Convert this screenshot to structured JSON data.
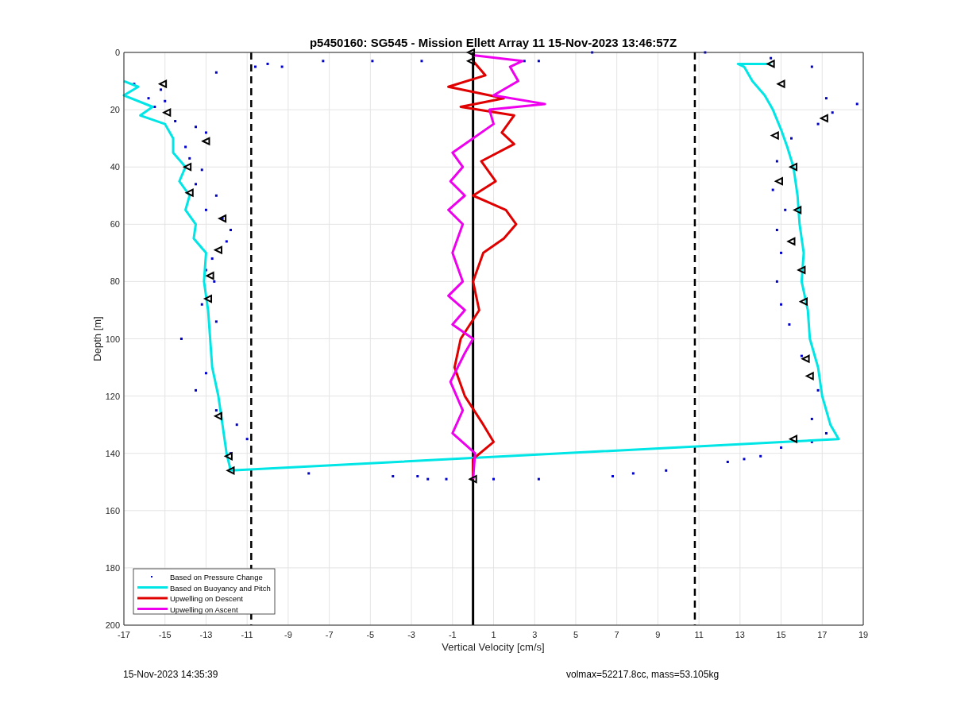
{
  "figure": {
    "chart_data": {
      "type": "line",
      "title": "p5450160: SG545 - Mission Ellett Array 11 15-Nov-2023 13:46:57Z",
      "xlabel": "Vertical Velocity [cm/s]",
      "ylabel": "Depth [m]",
      "xlim": [
        -17,
        19
      ],
      "ylim": [
        200,
        0
      ],
      "xticks": [
        -17,
        -15,
        -13,
        -11,
        -9,
        -7,
        -5,
        -3,
        -1,
        1,
        3,
        5,
        7,
        9,
        11,
        13,
        15,
        17,
        19
      ],
      "yticks": [
        0,
        20,
        40,
        60,
        80,
        100,
        120,
        140,
        160,
        180,
        200
      ],
      "series": [
        {
          "name": "Based on Pressure Change",
          "type": "scatter",
          "color": "#0000cc",
          "x": [
            -16.5,
            -15.2,
            -15.8,
            -15,
            -15.5,
            -14.5,
            -13.5,
            -13,
            -14,
            -13.8,
            -13.2,
            -13.5,
            -12.5,
            -13,
            -12.2,
            -11.8,
            -12,
            -12.7,
            -13,
            -12.6,
            -13.2,
            -12.5,
            -14.2,
            -13,
            -13.5,
            -12.5,
            -11.5,
            -11,
            -11.8,
            -12.5,
            -10.6,
            -10,
            -9.3,
            -7.3,
            -4.9,
            -2.5,
            2.5,
            3.2,
            5.8,
            -8,
            -3.9,
            -2.7,
            -2.2,
            -1.3,
            1,
            3.2,
            6.8,
            7.8,
            9.4,
            12.4,
            13.2,
            14,
            15,
            16.5,
            17.2,
            16.5,
            16.8,
            16,
            15.4,
            15,
            14.8,
            15,
            14.8,
            15.2,
            14.6,
            14.8,
            15.5,
            16.8,
            17.5,
            17.2,
            18.7,
            16.5,
            14.5,
            11.3
          ],
          "values": [
            11,
            13,
            16,
            17,
            19,
            24,
            26,
            28,
            33,
            37,
            41,
            46,
            50,
            55,
            58,
            62,
            66,
            72,
            76,
            80,
            88,
            94,
            100,
            112,
            118,
            125,
            130,
            135,
            140,
            7,
            5,
            4,
            5,
            3,
            3,
            3,
            3,
            3,
            0,
            147,
            148,
            148,
            149,
            149,
            149,
            149,
            148,
            147,
            146,
            143,
            142,
            141,
            138,
            136,
            133,
            128,
            118,
            106,
            95,
            88,
            80,
            70,
            62,
            55,
            48,
            38,
            30,
            25,
            21,
            16,
            18,
            5,
            2,
            0
          ]
        },
        {
          "name": "Based on Buoyancy and Pitch",
          "type": "line",
          "color": "#00e5e5",
          "x": [
            -17,
            -16.3,
            -17,
            -15.6,
            -16.2,
            -15,
            -14.6,
            -14.6,
            -14,
            -14.3,
            -13.8,
            -14,
            -13.5,
            -13.6,
            -13,
            -13.1,
            -12.9,
            -12.8,
            -12.7,
            -12.4,
            -12.2,
            -12,
            -11.8,
            17.8,
            17.4,
            17,
            16.8,
            16.4,
            16.3,
            16,
            16.1,
            15.9,
            15.8,
            15.6,
            15.3,
            15,
            14.6,
            14.2,
            13.6,
            13.2,
            12.9,
            14.5
          ],
          "values": [
            10,
            12,
            15,
            19,
            22,
            25,
            30,
            35,
            40,
            45,
            50,
            55,
            60,
            65,
            70,
            80,
            90,
            100,
            110,
            120,
            130,
            140,
            146,
            135,
            130,
            120,
            110,
            100,
            90,
            80,
            70,
            60,
            50,
            40,
            33,
            27,
            20,
            15,
            10,
            5,
            4,
            4
          ]
        },
        {
          "name": "Upwelling on Descent",
          "type": "line",
          "color": "#e00000",
          "x": [
            0,
            0.6,
            -1.2,
            1.5,
            -0.6,
            2,
            1.4,
            2,
            0.4,
            1.1,
            0,
            1.6,
            2.1,
            1.5,
            0.5,
            0,
            0.3,
            -0.6,
            -0.9,
            -0.4,
            0.5,
            1,
            0,
            0
          ],
          "values": [
            3,
            8,
            12,
            16,
            19,
            22,
            28,
            32,
            38,
            45,
            50,
            55,
            60,
            65,
            70,
            80,
            90,
            100,
            110,
            120,
            130,
            136,
            142,
            149
          ]
        },
        {
          "name": "Upwelling on Ascent",
          "type": "line",
          "color": "#ee00ee",
          "x": [
            0,
            0.1,
            -1,
            -0.5,
            -1.1,
            -0.4,
            0,
            -1,
            -0.4,
            -1.2,
            -0.5,
            -1,
            -0.5,
            -1.2,
            -0.4,
            -1.1,
            -0.5,
            -1,
            1,
            0.8,
            3.5,
            1,
            2.2,
            1.8,
            2.4,
            0
          ],
          "values": [
            149,
            140,
            133,
            125,
            115,
            105,
            100,
            95,
            90,
            85,
            80,
            70,
            60,
            55,
            50,
            45,
            40,
            35,
            25,
            20,
            18,
            15,
            10,
            5,
            3,
            1
          ]
        },
        {
          "type": "scatter",
          "marker": "<",
          "color": "#000000",
          "x": [
            -15.1,
            -14.9,
            -13,
            -13.9,
            -13.8,
            -12.2,
            -12.4,
            -12.8,
            -12.9,
            -12.4,
            -11.9,
            -11.8,
            -0.1,
            -0.1,
            0,
            14.5,
            15,
            17.1,
            14.7,
            15.6,
            14.9,
            15.8,
            15.5,
            16,
            16.1,
            16.2,
            16.4,
            15.6
          ],
          "values": [
            11,
            21,
            31,
            40,
            49,
            58,
            69,
            78,
            86,
            127,
            141,
            146,
            0,
            3,
            149,
            4,
            11,
            23,
            29,
            40,
            45,
            55,
            66,
            76,
            87,
            107,
            113,
            135
          ]
        }
      ],
      "ref_lines": [
        {
          "axis": "x",
          "value": -10.8
        },
        {
          "axis": "x",
          "value": 10.8
        },
        {
          "axis": "x",
          "value": 0
        }
      ],
      "grid": true,
      "legend": true
    }
  },
  "footer": {
    "timestamp": "15-Nov-2023 14:35:39",
    "summary": "volmax=52217.8cc, mass=53.105kg"
  }
}
